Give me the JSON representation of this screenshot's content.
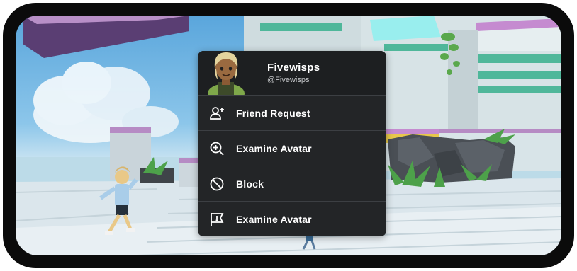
{
  "player": {
    "display_name": "Fivewisps",
    "username": "@Fivewisps"
  },
  "menu": {
    "items": [
      {
        "label": "Friend Request",
        "icon": "add-friend-icon"
      },
      {
        "label": "Examine Avatar",
        "icon": "zoom-in-icon"
      },
      {
        "label": "Block",
        "icon": "block-icon"
      },
      {
        "label": "Examine Avatar",
        "icon": "report-flag-icon"
      }
    ]
  },
  "colors": {
    "menu_background": "#232527",
    "menu_divider": "#3c3f43",
    "menu_text": "#ffffff",
    "username_text": "#c8cacd",
    "device_frame": "#0b0b0b"
  }
}
